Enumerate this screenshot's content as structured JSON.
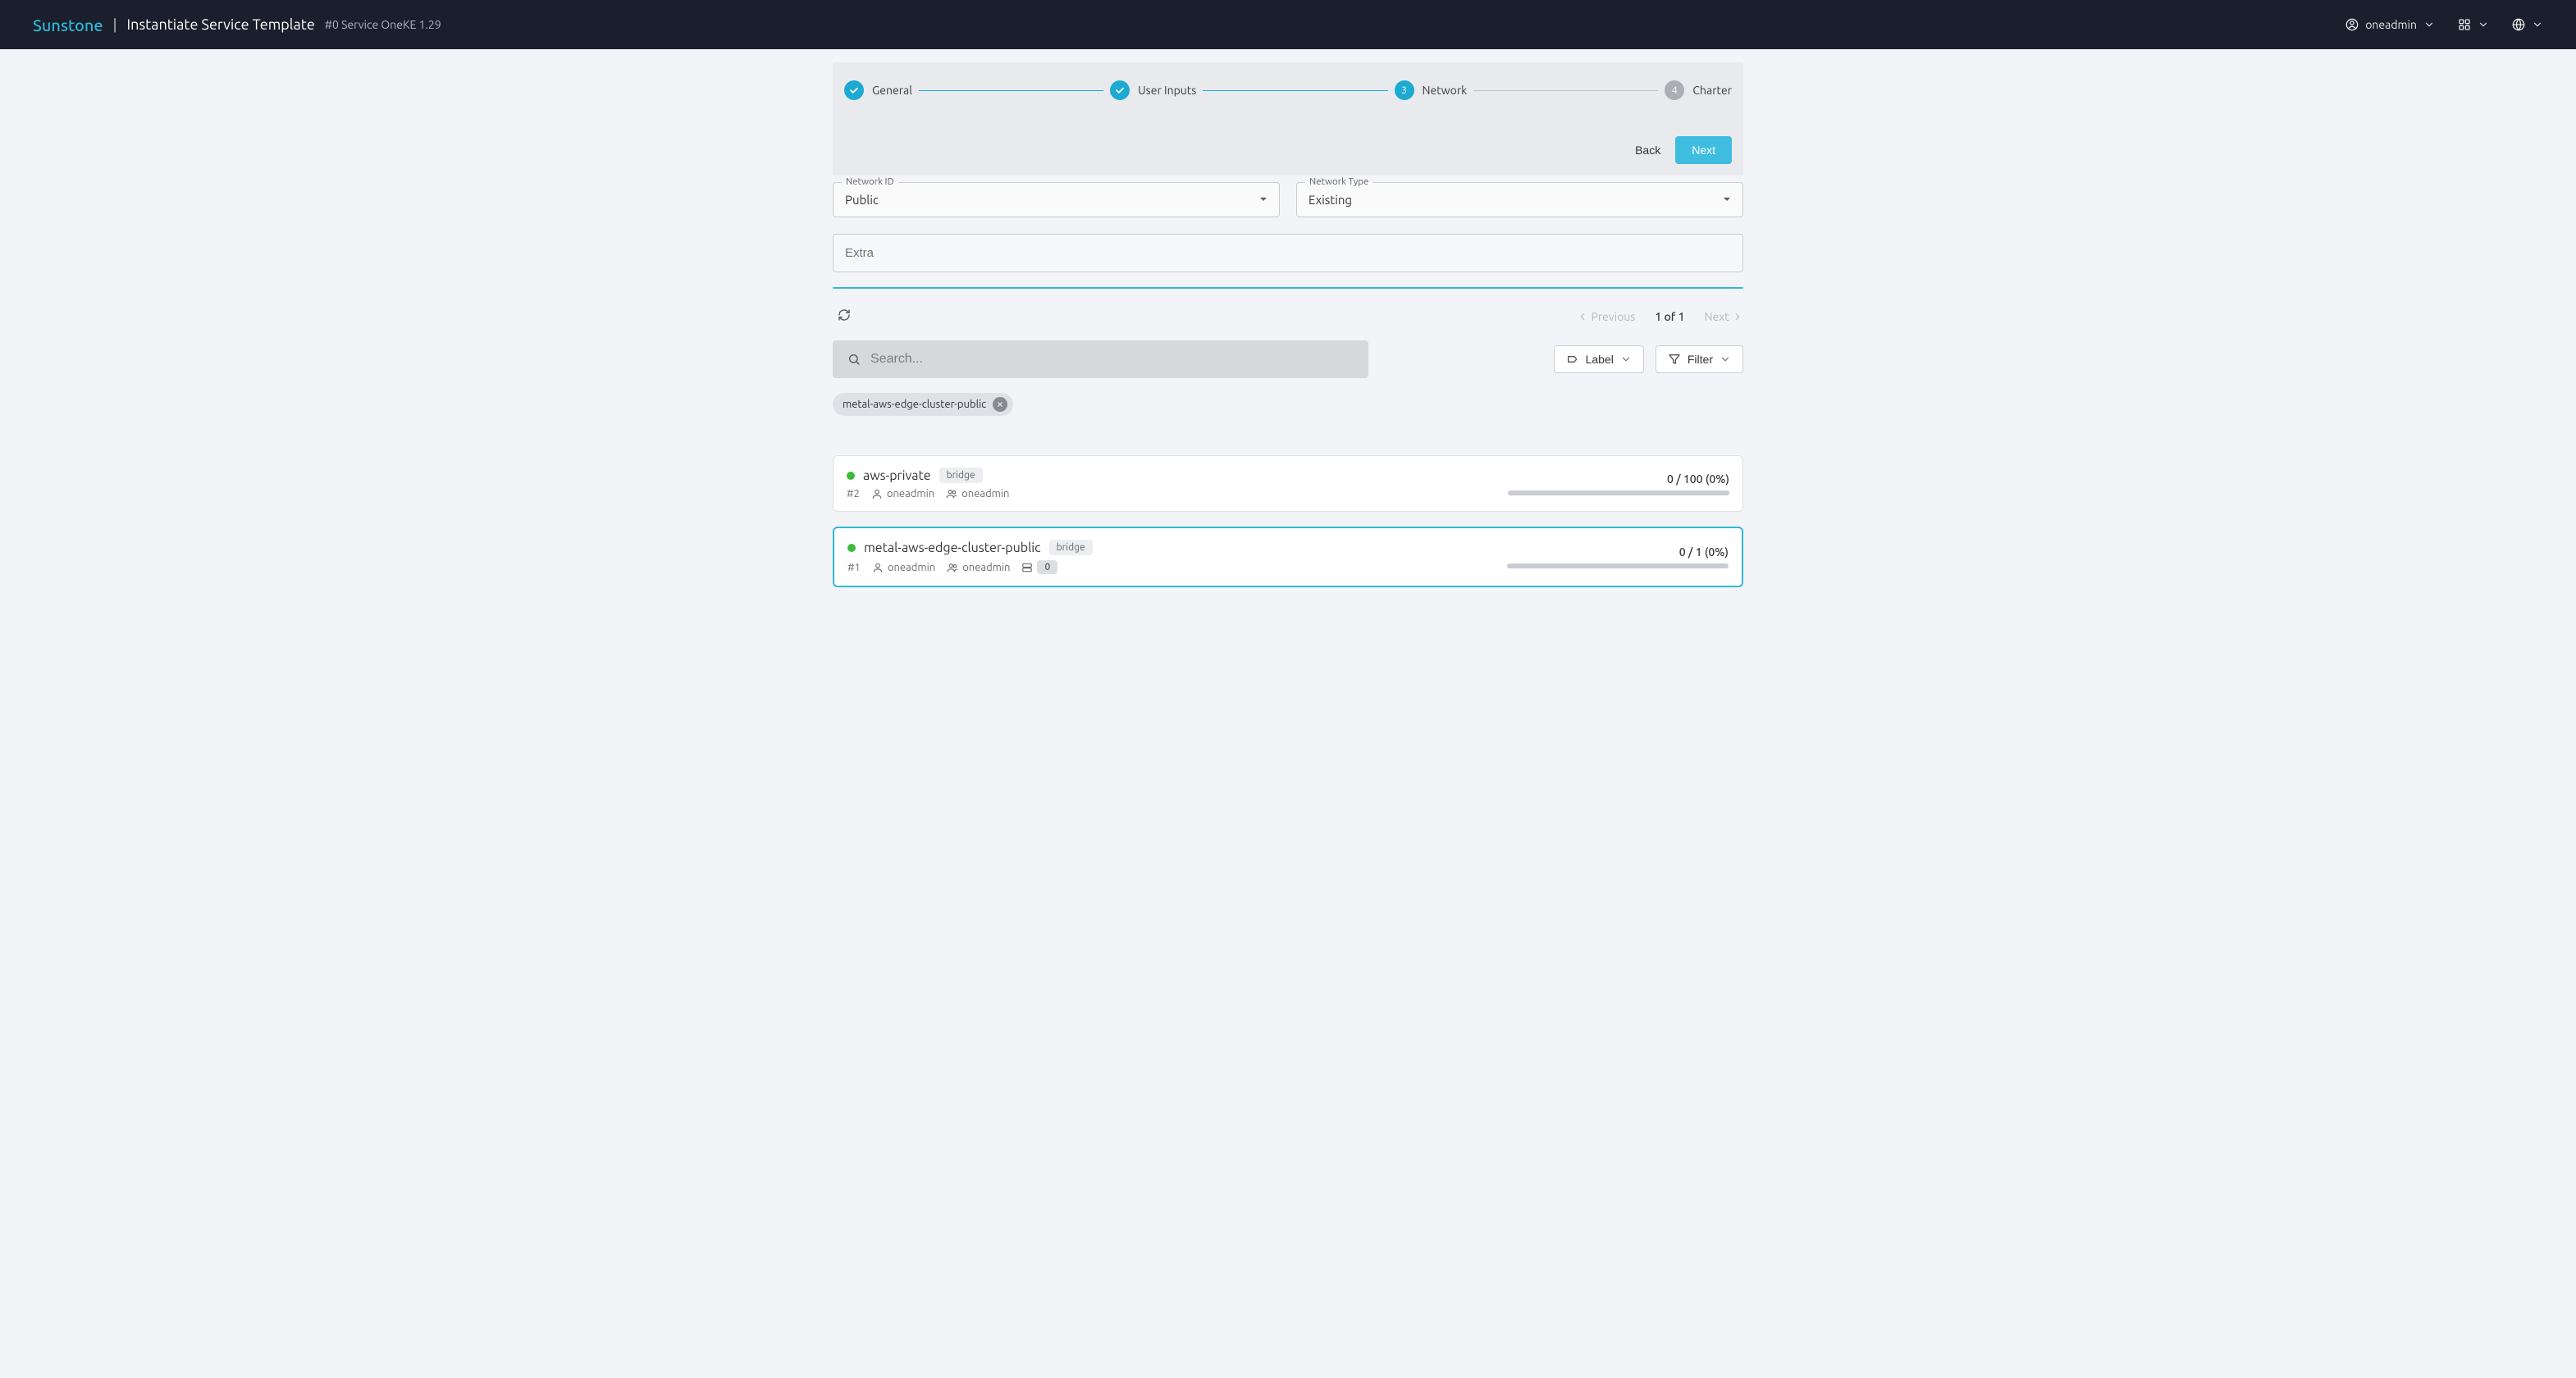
{
  "header": {
    "brand": "Sunstone",
    "title": "Instantiate Service Template",
    "breadcrumb": "#0 Service OneKE 1.29",
    "user": "oneadmin"
  },
  "stepper": {
    "steps": [
      "General",
      "User Inputs",
      "Network",
      "Charter"
    ],
    "back": "Back",
    "next": "Next"
  },
  "form": {
    "network_id_label": "Network ID",
    "network_id_value": "Public",
    "network_type_label": "Network Type",
    "network_type_value": "Existing",
    "extra_placeholder": "Extra"
  },
  "pager": {
    "previous": "Previous",
    "next": "Next",
    "status": "1 of 1"
  },
  "search": {
    "placeholder": "Search...",
    "label_btn": "Label",
    "filter_btn": "Filter"
  },
  "chips": {
    "chip0": "metal-aws-edge-cluster-public"
  },
  "networks": [
    {
      "name": "aws-private",
      "tag": "bridge",
      "id": "#2",
      "owner": "oneadmin",
      "group": "oneadmin",
      "usage": "0 / 100 (0%)",
      "selected": false,
      "extra_count": null
    },
    {
      "name": "metal-aws-edge-cluster-public",
      "tag": "bridge",
      "id": "#1",
      "owner": "oneadmin",
      "group": "oneadmin",
      "usage": "0 / 1 (0%)",
      "selected": true,
      "extra_count": "0"
    }
  ]
}
